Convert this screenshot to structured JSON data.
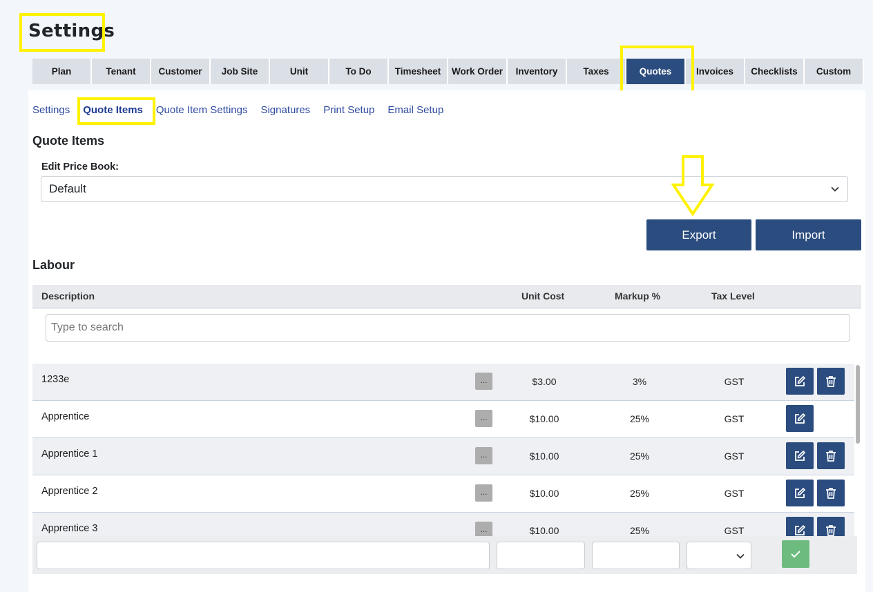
{
  "page": {
    "title": "Settings"
  },
  "tabs": [
    {
      "label": "Plan",
      "active": false
    },
    {
      "label": "Tenant",
      "active": false
    },
    {
      "label": "Customer",
      "active": false
    },
    {
      "label": "Job Site",
      "active": false
    },
    {
      "label": "Unit",
      "active": false
    },
    {
      "label": "To Do",
      "active": false
    },
    {
      "label": "Timesheet",
      "active": false
    },
    {
      "label": "Work Order",
      "active": false
    },
    {
      "label": "Inventory",
      "active": false
    },
    {
      "label": "Taxes",
      "active": false
    },
    {
      "label": "Quotes",
      "active": true
    },
    {
      "label": "Invoices",
      "active": false
    },
    {
      "label": "Checklists",
      "active": false
    },
    {
      "label": "Custom",
      "active": false
    }
  ],
  "subnav": [
    {
      "label": "Settings",
      "active": false
    },
    {
      "label": "Quote Items",
      "active": true
    },
    {
      "label": "Quote Item Settings",
      "active": false
    },
    {
      "label": "Signatures",
      "active": false
    },
    {
      "label": "Print Setup",
      "active": false
    },
    {
      "label": "Email Setup",
      "active": false
    }
  ],
  "quote_items": {
    "heading": "Quote Items",
    "price_book_label": "Edit Price Book:",
    "price_book_value": "Default",
    "export_label": "Export",
    "import_label": "Import"
  },
  "labour": {
    "heading": "Labour",
    "columns": {
      "description": "Description",
      "unit_cost": "Unit Cost",
      "markup": "Markup %",
      "tax_level": "Tax Level"
    },
    "search_placeholder": "Type to search",
    "more_label": "...",
    "rows": [
      {
        "description": "1233e",
        "unit_cost": "$3.00",
        "markup": "3%",
        "tax_level": "GST",
        "can_delete": true
      },
      {
        "description": "Apprentice",
        "unit_cost": "$10.00",
        "markup": "25%",
        "tax_level": "GST",
        "can_delete": false
      },
      {
        "description": "Apprentice 1",
        "unit_cost": "$10.00",
        "markup": "25%",
        "tax_level": "GST",
        "can_delete": true
      },
      {
        "description": "Apprentice 2",
        "unit_cost": "$10.00",
        "markup": "25%",
        "tax_level": "GST",
        "can_delete": true
      },
      {
        "description": "Apprentice 3",
        "unit_cost": "$10.00",
        "markup": "25%",
        "tax_level": "GST",
        "can_delete": true
      }
    ]
  },
  "new_item": {
    "description": "",
    "unit_cost": "",
    "markup": "",
    "tax_level": ""
  },
  "icons": {
    "edit": "edit-icon",
    "delete": "trash-icon",
    "confirm": "check-icon",
    "dropdown": "chevron-down-icon",
    "annotation_arrow": "down-arrow-icon"
  },
  "colors": {
    "primary": "#2b4c7e",
    "highlight": "#fff200",
    "confirm": "#6dbb7f",
    "link": "#2e4aa0"
  }
}
